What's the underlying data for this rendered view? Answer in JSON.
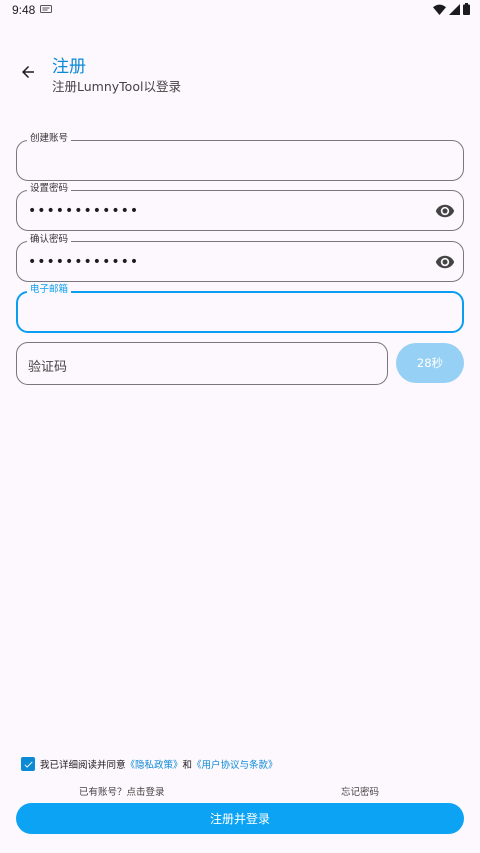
{
  "status_bar": {
    "time": "9:48",
    "icons": [
      "notification-icon",
      "wifi-icon",
      "signal-icon",
      "battery-icon"
    ]
  },
  "header": {
    "title": "注册",
    "subtitle": "注册LumnyTool以登录",
    "back_icon": "arrow-back-icon"
  },
  "form": {
    "username": {
      "label": "创建账号",
      "value": ""
    },
    "password": {
      "label": "设置密码",
      "value": "••••••••••••"
    },
    "confirm_password": {
      "label": "确认密码",
      "value": "••••••••••••"
    },
    "email": {
      "label": "电子邮箱",
      "value": ""
    },
    "code": {
      "placeholder": "验证码"
    },
    "countdown": "28秒"
  },
  "agreement": {
    "checked": true,
    "prefix": "我已详细阅读并同意",
    "privacy_link": "《隐私政策》",
    "joiner": "和",
    "terms_link": "《用户协议与条款》"
  },
  "footer": {
    "login_link": "已有账号？点击登录",
    "forgot_link": "忘记密码",
    "submit_label": "注册并登录"
  },
  "colors": {
    "accent": "#0b8ad6",
    "button": "#0ca3f5",
    "button_disabled": "#97d0f5",
    "background": "#fdf8fd"
  }
}
